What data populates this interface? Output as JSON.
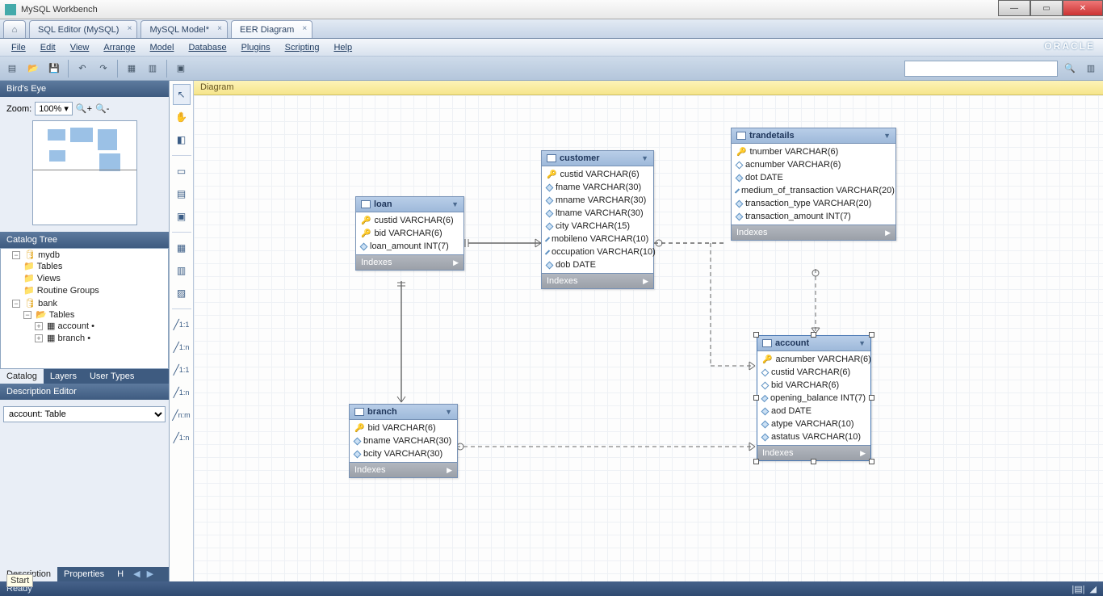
{
  "app_title": "MySQL Workbench",
  "tabs": [
    {
      "label": "SQL Editor (MySQL)",
      "active": false
    },
    {
      "label": "MySQL Model*",
      "active": false
    },
    {
      "label": "EER Diagram",
      "active": true
    }
  ],
  "menus": [
    "File",
    "Edit",
    "View",
    "Arrange",
    "Model",
    "Database",
    "Plugins",
    "Scripting",
    "Help"
  ],
  "oracle": "ORACLE",
  "left": {
    "birds_eye": "Bird's Eye",
    "zoom_label": "Zoom:",
    "zoom_value": "100%",
    "catalog_tree": "Catalog Tree",
    "tree": {
      "mydb": "mydb",
      "mydb_children": [
        "Tables",
        "Views",
        "Routine Groups"
      ],
      "bank": "bank",
      "bank_tables": "Tables",
      "bank_table_items": [
        "account",
        "branch"
      ]
    },
    "panel_tabs": [
      "Catalog",
      "Layers",
      "User Types"
    ],
    "description_editor": "Description Editor",
    "desc_value": "account: Table",
    "bottom_tabs": [
      "Description",
      "Properties",
      "H"
    ]
  },
  "diagram_header": "Diagram",
  "entities": {
    "loan": {
      "title": "loan",
      "cols": [
        {
          "icon": "key",
          "text": "custid VARCHAR(6)"
        },
        {
          "icon": "key",
          "text": "bid VARCHAR(6)"
        },
        {
          "icon": "dia",
          "text": "loan_amount INT(7)"
        }
      ],
      "indexes": "Indexes"
    },
    "customer": {
      "title": "customer",
      "cols": [
        {
          "icon": "key",
          "text": "custid VARCHAR(6)"
        },
        {
          "icon": "dia",
          "text": "fname VARCHAR(30)"
        },
        {
          "icon": "dia",
          "text": "mname VARCHAR(30)"
        },
        {
          "icon": "dia",
          "text": "ltname VARCHAR(30)"
        },
        {
          "icon": "dia",
          "text": "city VARCHAR(15)"
        },
        {
          "icon": "dia",
          "text": "mobileno VARCHAR(10)"
        },
        {
          "icon": "dia",
          "text": "occupation VARCHAR(10)"
        },
        {
          "icon": "dia",
          "text": "dob DATE"
        }
      ],
      "indexes": "Indexes"
    },
    "trandetails": {
      "title": "trandetails",
      "cols": [
        {
          "icon": "key",
          "text": "tnumber VARCHAR(6)"
        },
        {
          "icon": "diao",
          "text": "acnumber VARCHAR(6)"
        },
        {
          "icon": "dia",
          "text": "dot DATE"
        },
        {
          "icon": "dia",
          "text": "medium_of_transaction VARCHAR(20)"
        },
        {
          "icon": "dia",
          "text": "transaction_type VARCHAR(20)"
        },
        {
          "icon": "dia",
          "text": "transaction_amount INT(7)"
        }
      ],
      "indexes": "Indexes"
    },
    "branch": {
      "title": "branch",
      "cols": [
        {
          "icon": "key",
          "text": "bid VARCHAR(6)"
        },
        {
          "icon": "dia",
          "text": "bname VARCHAR(30)"
        },
        {
          "icon": "dia",
          "text": "bcity VARCHAR(30)"
        }
      ],
      "indexes": "Indexes"
    },
    "account": {
      "title": "account",
      "cols": [
        {
          "icon": "key",
          "text": "acnumber VARCHAR(6)"
        },
        {
          "icon": "diao",
          "text": "custid VARCHAR(6)"
        },
        {
          "icon": "diao",
          "text": "bid VARCHAR(6)"
        },
        {
          "icon": "dia",
          "text": "opening_balance INT(7)"
        },
        {
          "icon": "dia",
          "text": "aod DATE"
        },
        {
          "icon": "dia",
          "text": "atype VARCHAR(10)"
        },
        {
          "icon": "dia",
          "text": "astatus VARCHAR(10)"
        }
      ],
      "indexes": "Indexes"
    }
  },
  "palette_rel_labels": [
    "1:1",
    "1:n",
    "1:1",
    "1:n",
    "n:m",
    "1:n"
  ],
  "status": {
    "ready": "Ready"
  },
  "start_tooltip": "Start"
}
